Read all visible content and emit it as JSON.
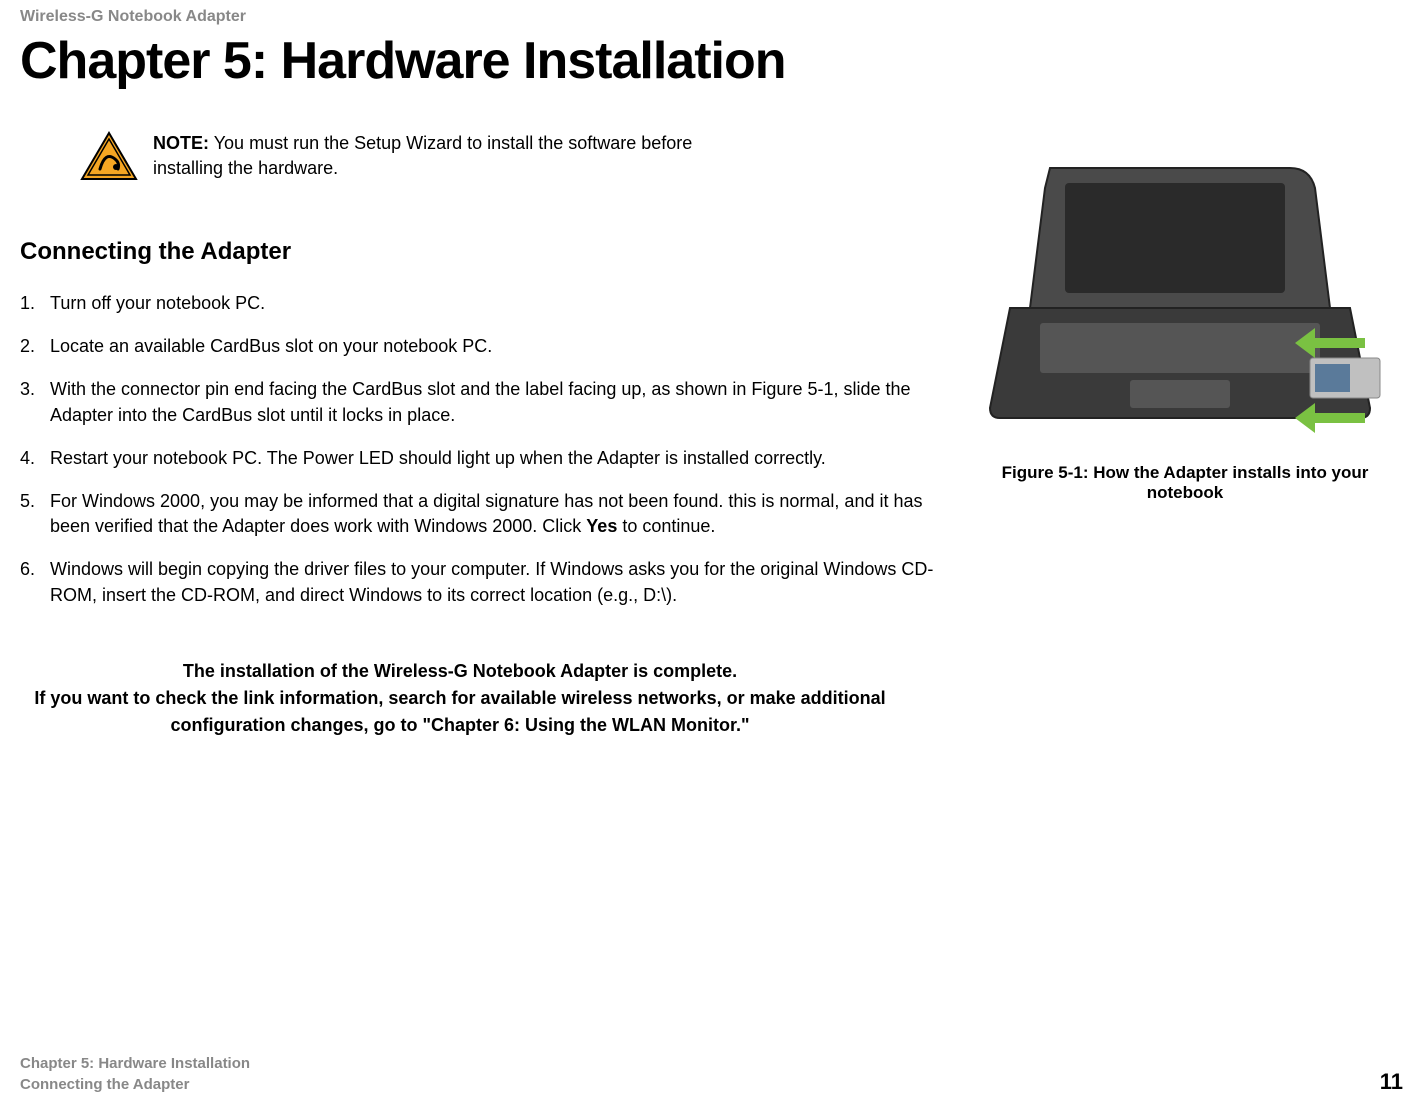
{
  "header": {
    "product": "Wireless-G Notebook Adapter"
  },
  "chapter": {
    "title": "Chapter 5: Hardware Installation"
  },
  "note": {
    "label": "NOTE:",
    "text": "You must run the Setup Wizard to install the software before installing the hardware."
  },
  "section": {
    "title": "Connecting the Adapter"
  },
  "steps": [
    "Turn off your notebook PC.",
    "Locate an available CardBus slot on your notebook PC.",
    "With the connector pin end facing the CardBus slot and the label facing up, as shown in Figure 5-1, slide the Adapter into the CardBus slot until it locks in place.",
    "Restart your notebook PC. The Power LED should light up when the Adapter is installed correctly.",
    "For Windows 2000, you may be informed that a digital signature has not been found. this is normal, and it has been verified that the Adapter does work with Windows 2000. Click Yes to continue.",
    "Windows will begin copying the driver files to your computer. If Windows asks you for the original Windows CD-ROM, insert the CD-ROM, and direct Windows to its correct location (e.g., D:\\)."
  ],
  "step5_bold": "Yes",
  "completion": {
    "line1": "The installation of the Wireless-G Notebook Adapter is complete.",
    "line2": "If you want to check the link information, search for available wireless networks, or make additional configuration changes, go to \"Chapter 6: Using the WLAN Monitor.\""
  },
  "figure": {
    "caption": "Figure 5-1: How the Adapter installs into your notebook"
  },
  "footer": {
    "chapter": "Chapter 5: Hardware Installation",
    "section": "Connecting the Adapter",
    "page": "11"
  }
}
